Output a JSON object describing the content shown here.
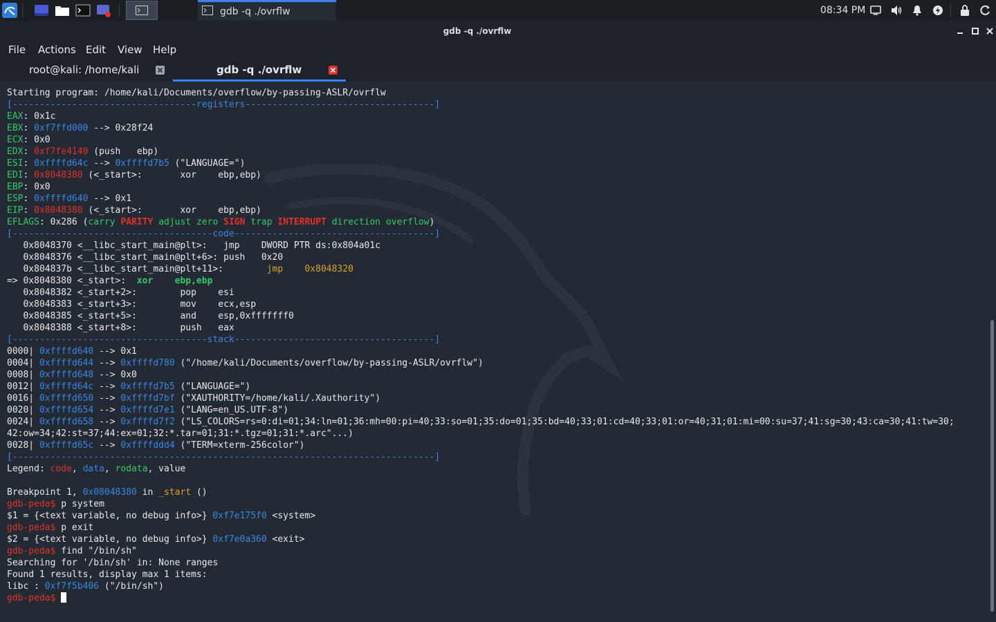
{
  "taskbar": {
    "task_label": "gdb -q ./ovrflw",
    "clock": "08:34 PM"
  },
  "window": {
    "title": "gdb -q ./ovrflw"
  },
  "menu": {
    "file": "File",
    "actions": "Actions",
    "edit": "Edit",
    "view": "View",
    "help": "Help"
  },
  "tabs": [
    {
      "label": "root@kali: /home/kali",
      "active": false
    },
    {
      "label": "gdb -q ./ovrflw",
      "active": true
    }
  ],
  "colors": {
    "accent": "#3b82f6",
    "red": "#e0312d",
    "blue": "#3a86e6",
    "green": "#34c86a",
    "yellow": "#d7a128",
    "cyan": "#3fb8b0"
  },
  "terminal": {
    "lines": [
      [
        {
          "t": "Starting program: /home/kali/Documents/overflow/by-passing-ASLR/ovrflw"
        }
      ],
      [
        {
          "t": "[----------------------------------registers-----------------------------------]",
          "c": "blue"
        }
      ],
      [
        {
          "t": "EAX",
          "c": "green"
        },
        {
          "t": ": 0x1c"
        }
      ],
      [
        {
          "t": "EBX",
          "c": "green"
        },
        {
          "t": ": "
        },
        {
          "t": "0xf7ffd000",
          "c": "blue"
        },
        {
          "t": " --> 0x28f24"
        }
      ],
      [
        {
          "t": "ECX",
          "c": "green"
        },
        {
          "t": ": 0x0"
        }
      ],
      [
        {
          "t": "EDX",
          "c": "green"
        },
        {
          "t": ": "
        },
        {
          "t": "0xf7fe4140",
          "c": "red"
        },
        {
          "t": " (push   ebp)"
        }
      ],
      [
        {
          "t": "ESI",
          "c": "green"
        },
        {
          "t": ": "
        },
        {
          "t": "0xffffd64c",
          "c": "blue"
        },
        {
          "t": " --> "
        },
        {
          "t": "0xffffd7b5",
          "c": "blue"
        },
        {
          "t": " (\"LANGUAGE=\")"
        }
      ],
      [
        {
          "t": "EDI",
          "c": "green"
        },
        {
          "t": ": "
        },
        {
          "t": "0x8048380",
          "c": "red"
        },
        {
          "t": " (<_start>:       xor    ebp,ebp)"
        }
      ],
      [
        {
          "t": "EBP",
          "c": "green"
        },
        {
          "t": ": 0x0"
        }
      ],
      [
        {
          "t": "ESP",
          "c": "green"
        },
        {
          "t": ": "
        },
        {
          "t": "0xffffd640",
          "c": "blue"
        },
        {
          "t": " --> 0x1"
        }
      ],
      [
        {
          "t": "EIP",
          "c": "green"
        },
        {
          "t": ": "
        },
        {
          "t": "0x8048380",
          "c": "red"
        },
        {
          "t": " (<_start>:       xor    ebp,ebp)"
        }
      ],
      [
        {
          "t": "EFLAGS",
          "c": "green"
        },
        {
          "t": ": 0x286 ("
        },
        {
          "t": "carry",
          "c": "green"
        },
        {
          "t": " "
        },
        {
          "t": "PARITY",
          "c": "red-bold"
        },
        {
          "t": " "
        },
        {
          "t": "adjust",
          "c": "green"
        },
        {
          "t": " "
        },
        {
          "t": "zero",
          "c": "green"
        },
        {
          "t": " "
        },
        {
          "t": "SIGN",
          "c": "red-bold"
        },
        {
          "t": " "
        },
        {
          "t": "trap",
          "c": "green"
        },
        {
          "t": " "
        },
        {
          "t": "INTERRUPT",
          "c": "red-bold"
        },
        {
          "t": " "
        },
        {
          "t": "direction",
          "c": "green"
        },
        {
          "t": " "
        },
        {
          "t": "overflow",
          "c": "green"
        },
        {
          "t": ")"
        }
      ],
      [
        {
          "t": "[-------------------------------------code-------------------------------------]",
          "c": "blue"
        }
      ],
      [
        {
          "t": "   0x8048370 <__libc_start_main@plt>:   jmp    DWORD PTR ds:0x804a01c"
        }
      ],
      [
        {
          "t": "   0x8048376 <__libc_start_main@plt+6>: push   0x20"
        }
      ],
      [
        {
          "t": "   0x804837b <__libc_start_main@plt+11>:        "
        },
        {
          "t": "jmp    0x8048320",
          "c": "yellow"
        }
      ],
      [
        {
          "t": "=> 0x8048380 <_start>:  "
        },
        {
          "t": "xor    ebp,ebp",
          "c": "green-bold"
        }
      ],
      [
        {
          "t": "   0x8048382 <_start+2>:        pop    esi"
        }
      ],
      [
        {
          "t": "   0x8048383 <_start+3>:        mov    ecx,esp"
        }
      ],
      [
        {
          "t": "   0x8048385 <_start+5>:        and    esp,0xfffffff0"
        }
      ],
      [
        {
          "t": "   0x8048388 <_start+8>:        push   eax"
        }
      ],
      [
        {
          "t": "[------------------------------------stack-------------------------------------]",
          "c": "blue"
        }
      ],
      [
        {
          "t": "0000| "
        },
        {
          "t": "0xffffd640",
          "c": "blue"
        },
        {
          "t": " --> 0x1"
        }
      ],
      [
        {
          "t": "0004| "
        },
        {
          "t": "0xffffd644",
          "c": "blue"
        },
        {
          "t": " --> "
        },
        {
          "t": "0xffffd780",
          "c": "blue"
        },
        {
          "t": " (\"/home/kali/Documents/overflow/by-passing-ASLR/ovrflw\")"
        }
      ],
      [
        {
          "t": "0008| "
        },
        {
          "t": "0xffffd648",
          "c": "blue"
        },
        {
          "t": " --> 0x0"
        }
      ],
      [
        {
          "t": "0012| "
        },
        {
          "t": "0xffffd64c",
          "c": "blue"
        },
        {
          "t": " --> "
        },
        {
          "t": "0xffffd7b5",
          "c": "blue"
        },
        {
          "t": " (\"LANGUAGE=\")"
        }
      ],
      [
        {
          "t": "0016| "
        },
        {
          "t": "0xffffd650",
          "c": "blue"
        },
        {
          "t": " --> "
        },
        {
          "t": "0xffffd7bf",
          "c": "blue"
        },
        {
          "t": " (\"XAUTHORITY=/home/kali/.Xauthority\")"
        }
      ],
      [
        {
          "t": "0020| "
        },
        {
          "t": "0xffffd654",
          "c": "blue"
        },
        {
          "t": " --> "
        },
        {
          "t": "0xffffd7e1",
          "c": "blue"
        },
        {
          "t": " (\"LANG=en_US.UTF-8\")"
        }
      ],
      [
        {
          "t": "0024| "
        },
        {
          "t": "0xffffd658",
          "c": "blue"
        },
        {
          "t": " --> "
        },
        {
          "t": "0xffffd7f2",
          "c": "blue"
        },
        {
          "t": " (\"LS_COLORS=rs=0:di=01;34:ln=01;36:mh=00:pi=40;33:so=01;35:do=01;35:bd=40;33;01:cd=40;33;01:or=40;31;01:mi=00:su=37;41:sg=30;43:ca=30;41:tw=30;"
        }
      ],
      [
        {
          "t": "42:ow=34;42:st=37;44:ex=01;32:*.tar=01;31:*.tgz=01;31:*.arc\"...)"
        }
      ],
      [
        {
          "t": "0028| "
        },
        {
          "t": "0xffffd65c",
          "c": "blue"
        },
        {
          "t": " --> "
        },
        {
          "t": "0xffffddd4",
          "c": "blue"
        },
        {
          "t": " (\"TERM=xterm-256color\")"
        }
      ],
      [
        {
          "t": "[------------------------------------------------------------------------------]",
          "c": "blue"
        }
      ],
      [
        {
          "t": "Legend: "
        },
        {
          "t": "code",
          "c": "red"
        },
        {
          "t": ", "
        },
        {
          "t": "data",
          "c": "blue"
        },
        {
          "t": ", "
        },
        {
          "t": "rodata",
          "c": "green"
        },
        {
          "t": ", value"
        }
      ],
      [
        {
          "t": ""
        }
      ],
      [
        {
          "t": "Breakpoint 1, "
        },
        {
          "t": "0x08048380",
          "c": "blue"
        },
        {
          "t": " in "
        },
        {
          "t": "_start",
          "c": "yellow"
        },
        {
          "t": " ()"
        }
      ],
      [
        {
          "t": "gdb-peda$",
          "c": "red"
        },
        {
          "t": " p system"
        }
      ],
      [
        {
          "t": "$1 = {<text variable, no debug info>} "
        },
        {
          "t": "0xf7e175f0",
          "c": "blue"
        },
        {
          "t": " <system>"
        }
      ],
      [
        {
          "t": "gdb-peda$",
          "c": "red"
        },
        {
          "t": " p exit"
        }
      ],
      [
        {
          "t": "$2 = {<text variable, no debug info>} "
        },
        {
          "t": "0xf7e0a360",
          "c": "blue"
        },
        {
          "t": " <exit>"
        }
      ],
      [
        {
          "t": "gdb-peda$",
          "c": "red"
        },
        {
          "t": " find \"/bin/sh\""
        }
      ],
      [
        {
          "t": "Searching for '/bin/sh' in: None ranges"
        }
      ],
      [
        {
          "t": "Found 1 results, display max 1 items:"
        }
      ],
      [
        {
          "t": "libc : "
        },
        {
          "t": "0xf7f5b406",
          "c": "blue"
        },
        {
          "t": " (\"/bin/sh\")"
        }
      ],
      [
        {
          "t": "gdb-peda$",
          "c": "red"
        },
        {
          "t": " "
        },
        {
          "t": "",
          "c": "cursor"
        }
      ]
    ]
  }
}
